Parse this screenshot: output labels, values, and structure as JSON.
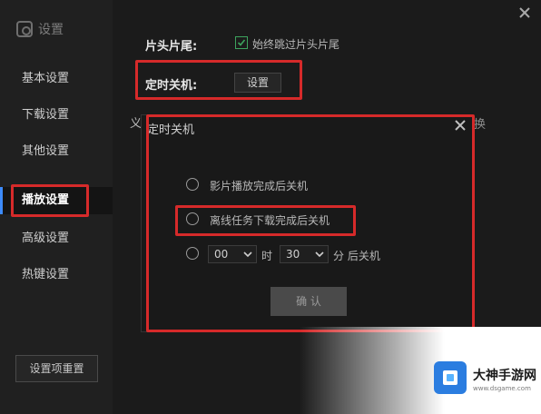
{
  "window": {
    "title": "设置",
    "close_icon": "close-icon"
  },
  "sidebar": {
    "items": [
      {
        "label": "基本设置",
        "active": false
      },
      {
        "label": "下载设置",
        "active": false
      },
      {
        "label": "其他设置",
        "active": false
      },
      {
        "label": "播放设置",
        "active": true
      },
      {
        "label": "高级设置",
        "active": false
      },
      {
        "label": "热键设置",
        "active": false
      }
    ],
    "reset_label": "设置项重置"
  },
  "playback": {
    "skip_label": "片头片尾:",
    "skip_checkbox_label": "始终跳过片头片尾",
    "skip_checked": true,
    "timer_label": "定时关机:",
    "timer_button": "设置",
    "partial_left": "义",
    "partial_right": "换"
  },
  "dialog": {
    "title": "定时关机",
    "options": [
      {
        "label": "影片播放完成后关机"
      },
      {
        "label": "离线任务下载完成后关机"
      }
    ],
    "time": {
      "hour": "00",
      "hour_unit": "时",
      "minute": "30",
      "minute_unit": "分 后关机"
    },
    "confirm": "确 认"
  },
  "watermark": {
    "name": "大神手游网",
    "url": "www.dsgame.com"
  },
  "colors": {
    "highlight": "#d62a2a",
    "check": "#3da35d",
    "brand": "#2b7de0"
  }
}
